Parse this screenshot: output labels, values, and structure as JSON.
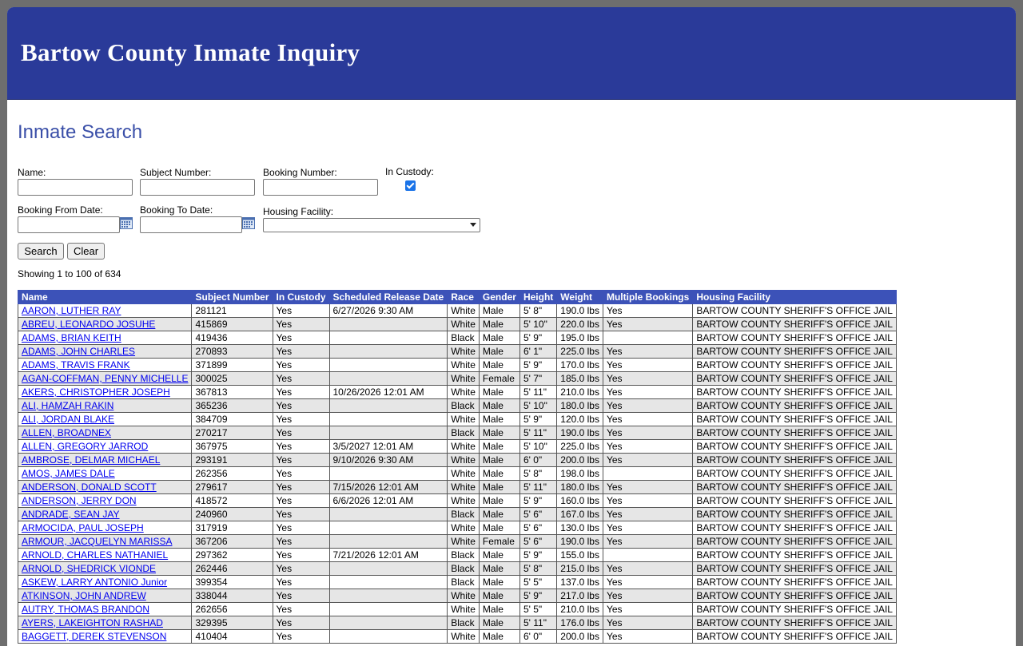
{
  "header": {
    "title": "Bartow County Inmate Inquiry"
  },
  "search": {
    "title": "Inmate Search",
    "name_label": "Name:",
    "name_value": "",
    "subject_label": "Subject Number:",
    "subject_value": "",
    "booking_label": "Booking Number:",
    "booking_value": "",
    "custody_label": "In Custody:",
    "custody_checked": true,
    "from_label": "Booking From Date:",
    "from_value": "",
    "to_label": "Booking To Date:",
    "to_value": "",
    "facility_label": "Housing Facility:",
    "facility_value": "",
    "search_button": "Search",
    "clear_button": "Clear"
  },
  "results": {
    "showing": "Showing 1 to 100 of 634",
    "columns": [
      "Name",
      "Subject Number",
      "In Custody",
      "Scheduled Release Date",
      "Race",
      "Gender",
      "Height",
      "Weight",
      "Multiple Bookings",
      "Housing Facility"
    ],
    "rows": [
      [
        "AARON, LUTHER RAY",
        "281121",
        "Yes",
        "6/27/2026 9:30 AM",
        "White",
        "Male",
        "5' 8\"",
        "190.0 lbs",
        "Yes",
        "BARTOW COUNTY SHERIFF'S OFFICE JAIL"
      ],
      [
        "ABREU, LEONARDO JOSUHE",
        "415869",
        "Yes",
        "",
        "White",
        "Male",
        "5' 10\"",
        "220.0 lbs",
        "Yes",
        "BARTOW COUNTY SHERIFF'S OFFICE JAIL"
      ],
      [
        "ADAMS, BRIAN KEITH",
        "419436",
        "Yes",
        "",
        "Black",
        "Male",
        "5' 9\"",
        "195.0 lbs",
        "",
        "BARTOW COUNTY SHERIFF'S OFFICE JAIL"
      ],
      [
        "ADAMS, JOHN CHARLES",
        "270893",
        "Yes",
        "",
        "White",
        "Male",
        "6' 1\"",
        "225.0 lbs",
        "Yes",
        "BARTOW COUNTY SHERIFF'S OFFICE JAIL"
      ],
      [
        "ADAMS, TRAVIS FRANK",
        "371899",
        "Yes",
        "",
        "White",
        "Male",
        "5' 9\"",
        "170.0 lbs",
        "Yes",
        "BARTOW COUNTY SHERIFF'S OFFICE JAIL"
      ],
      [
        "AGAN-COFFMAN, PENNY MICHELLE",
        "300025",
        "Yes",
        "",
        "White",
        "Female",
        "5' 7\"",
        "185.0 lbs",
        "Yes",
        "BARTOW COUNTY SHERIFF'S OFFICE JAIL"
      ],
      [
        "AKERS, CHRISTOPHER JOSEPH",
        "367813",
        "Yes",
        "10/26/2026 12:01 AM",
        "White",
        "Male",
        "5' 11\"",
        "210.0 lbs",
        "Yes",
        "BARTOW COUNTY SHERIFF'S OFFICE JAIL"
      ],
      [
        "ALI, HAMZAH RAKIN",
        "365236",
        "Yes",
        "",
        "Black",
        "Male",
        "5' 10\"",
        "180.0 lbs",
        "Yes",
        "BARTOW COUNTY SHERIFF'S OFFICE JAIL"
      ],
      [
        "ALI, JORDAN BLAKE",
        "384709",
        "Yes",
        "",
        "White",
        "Male",
        "5' 9\"",
        "120.0 lbs",
        "Yes",
        "BARTOW COUNTY SHERIFF'S OFFICE JAIL"
      ],
      [
        "ALLEN, BROADNEX",
        "270217",
        "Yes",
        "",
        "Black",
        "Male",
        "5' 11\"",
        "190.0 lbs",
        "Yes",
        "BARTOW COUNTY SHERIFF'S OFFICE JAIL"
      ],
      [
        "ALLEN, GREGORY JARROD",
        "367975",
        "Yes",
        "3/5/2027 12:01 AM",
        "White",
        "Male",
        "5' 10\"",
        "225.0 lbs",
        "Yes",
        "BARTOW COUNTY SHERIFF'S OFFICE JAIL"
      ],
      [
        "AMBROSE, DELMAR MICHAEL",
        "293191",
        "Yes",
        "9/10/2026 9:30 AM",
        "White",
        "Male",
        "6' 0\"",
        "200.0 lbs",
        "Yes",
        "BARTOW COUNTY SHERIFF'S OFFICE JAIL"
      ],
      [
        "AMOS, JAMES DALE",
        "262356",
        "Yes",
        "",
        "White",
        "Male",
        "5' 8\"",
        "198.0 lbs",
        "",
        "BARTOW COUNTY SHERIFF'S OFFICE JAIL"
      ],
      [
        "ANDERSON, DONALD SCOTT",
        "279617",
        "Yes",
        "7/15/2026 12:01 AM",
        "White",
        "Male",
        "5' 11\"",
        "180.0 lbs",
        "Yes",
        "BARTOW COUNTY SHERIFF'S OFFICE JAIL"
      ],
      [
        "ANDERSON, JERRY DON",
        "418572",
        "Yes",
        "6/6/2026 12:01 AM",
        "White",
        "Male",
        "5' 9\"",
        "160.0 lbs",
        "Yes",
        "BARTOW COUNTY SHERIFF'S OFFICE JAIL"
      ],
      [
        "ANDRADE, SEAN JAY",
        "240960",
        "Yes",
        "",
        "Black",
        "Male",
        "5' 6\"",
        "167.0 lbs",
        "Yes",
        "BARTOW COUNTY SHERIFF'S OFFICE JAIL"
      ],
      [
        "ARMOCIDA, PAUL JOSEPH",
        "317919",
        "Yes",
        "",
        "White",
        "Male",
        "5' 6\"",
        "130.0 lbs",
        "Yes",
        "BARTOW COUNTY SHERIFF'S OFFICE JAIL"
      ],
      [
        "ARMOUR, JACQUELYN MARISSA",
        "367206",
        "Yes",
        "",
        "White",
        "Female",
        "5' 6\"",
        "190.0 lbs",
        "Yes",
        "BARTOW COUNTY SHERIFF'S OFFICE JAIL"
      ],
      [
        "ARNOLD, CHARLES NATHANIEL",
        "297362",
        "Yes",
        "7/21/2026 12:01 AM",
        "Black",
        "Male",
        "5' 9\"",
        "155.0 lbs",
        "",
        "BARTOW COUNTY SHERIFF'S OFFICE JAIL"
      ],
      [
        "ARNOLD, SHEDRICK VIONDE",
        "262446",
        "Yes",
        "",
        "Black",
        "Male",
        "5' 8\"",
        "215.0 lbs",
        "Yes",
        "BARTOW COUNTY SHERIFF'S OFFICE JAIL"
      ],
      [
        "ASKEW, LARRY ANTONIO Junior",
        "399354",
        "Yes",
        "",
        "Black",
        "Male",
        "5' 5\"",
        "137.0 lbs",
        "Yes",
        "BARTOW COUNTY SHERIFF'S OFFICE JAIL"
      ],
      [
        "ATKINSON, JOHN ANDREW",
        "338044",
        "Yes",
        "",
        "White",
        "Male",
        "5' 9\"",
        "217.0 lbs",
        "Yes",
        "BARTOW COUNTY SHERIFF'S OFFICE JAIL"
      ],
      [
        "AUTRY, THOMAS BRANDON",
        "262656",
        "Yes",
        "",
        "White",
        "Male",
        "5' 5\"",
        "210.0 lbs",
        "Yes",
        "BARTOW COUNTY SHERIFF'S OFFICE JAIL"
      ],
      [
        "AYERS, LAKEIGHTON RASHAD",
        "329395",
        "Yes",
        "",
        "Black",
        "Male",
        "5' 11\"",
        "176.0 lbs",
        "Yes",
        "BARTOW COUNTY SHERIFF'S OFFICE JAIL"
      ],
      [
        "BAGGETT, DEREK STEVENSON",
        "410404",
        "Yes",
        "",
        "White",
        "Male",
        "6' 0\"",
        "200.0 lbs",
        "Yes",
        "BARTOW COUNTY SHERIFF'S OFFICE JAIL"
      ]
    ]
  }
}
